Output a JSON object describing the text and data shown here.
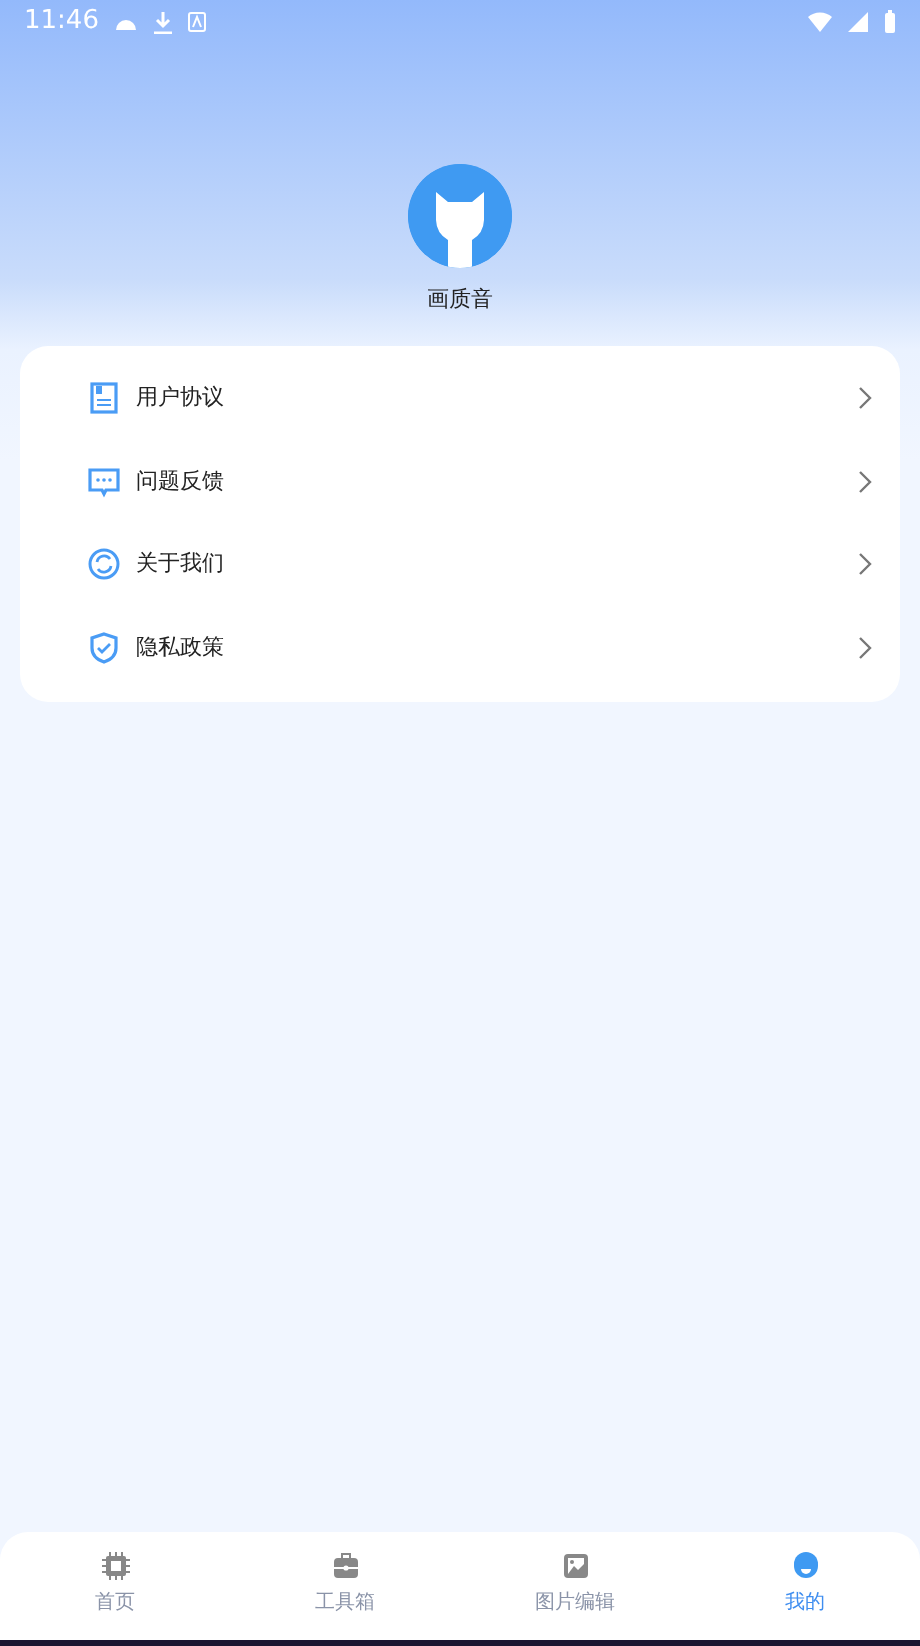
{
  "status_bar": {
    "time": "11:46"
  },
  "profile": {
    "name": "画质音"
  },
  "menu": [
    {
      "label": "用户协议",
      "kind": "document"
    },
    {
      "label": "问题反馈",
      "kind": "feedback"
    },
    {
      "label": "关于我们",
      "kind": "about"
    },
    {
      "label": "隐私政策",
      "kind": "privacy"
    }
  ],
  "tabs": [
    {
      "label": "首页",
      "kind": "home",
      "selected": false
    },
    {
      "label": "工具箱",
      "kind": "toolbox",
      "selected": false
    },
    {
      "label": "图片编辑",
      "kind": "image",
      "selected": false
    },
    {
      "label": "我的",
      "kind": "me",
      "selected": true
    }
  ]
}
